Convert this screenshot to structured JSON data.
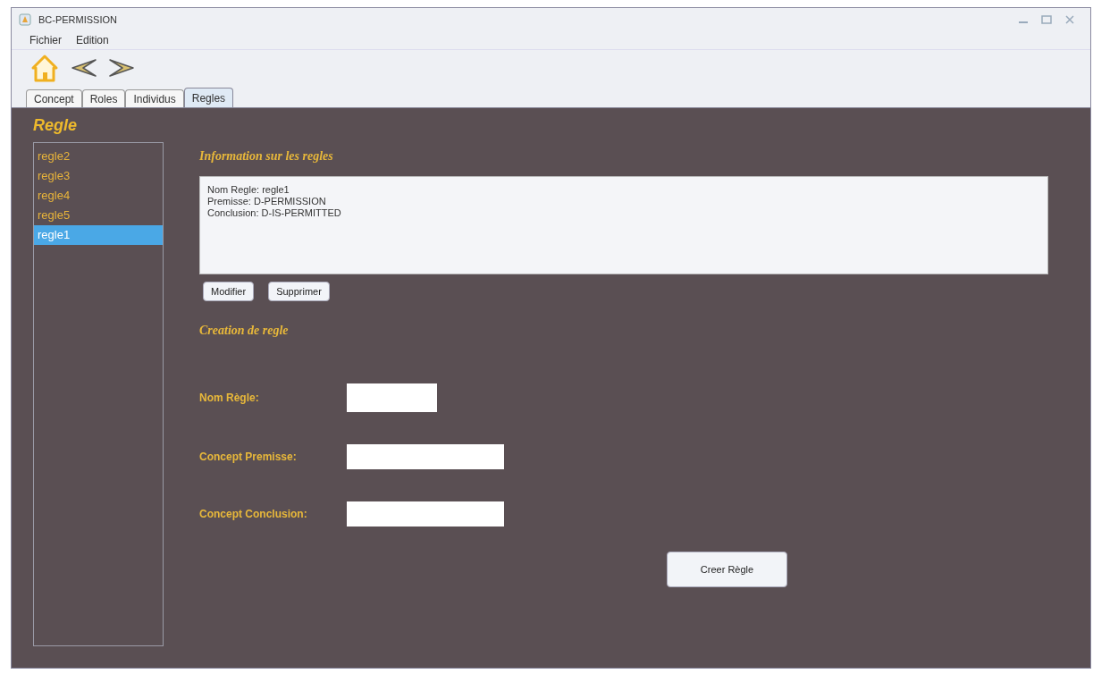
{
  "window": {
    "title": "BC-PERMISSION"
  },
  "menu": [
    "Fichier",
    "Edition"
  ],
  "tabs": [
    {
      "label": "Concept",
      "selected": false
    },
    {
      "label": "Roles",
      "selected": false
    },
    {
      "label": "Individus",
      "selected": false
    },
    {
      "label": "Regles",
      "selected": true
    }
  ],
  "panel_title": "Regle",
  "rule_list": [
    {
      "label": "regle2",
      "selected": false
    },
    {
      "label": "regle3",
      "selected": false
    },
    {
      "label": "regle4",
      "selected": false
    },
    {
      "label": "regle5",
      "selected": false
    },
    {
      "label": "regle1",
      "selected": true
    }
  ],
  "info": {
    "heading": "Information sur les regles",
    "lines": [
      "Nom Regle: regle1",
      "Premisse: D-PERMISSION",
      "Conclusion: D-IS-PERMITTED"
    ],
    "buttons": [
      "Modifier",
      "Supprimer"
    ]
  },
  "creation": {
    "heading": "Creation de regle",
    "fields": [
      {
        "label": "Nom Règle:",
        "kind": "short"
      },
      {
        "label": "Concept Premisse:",
        "kind": "long"
      },
      {
        "label": "Concept Conclusion:",
        "kind": "long"
      }
    ],
    "submit": "Creer Règle"
  }
}
